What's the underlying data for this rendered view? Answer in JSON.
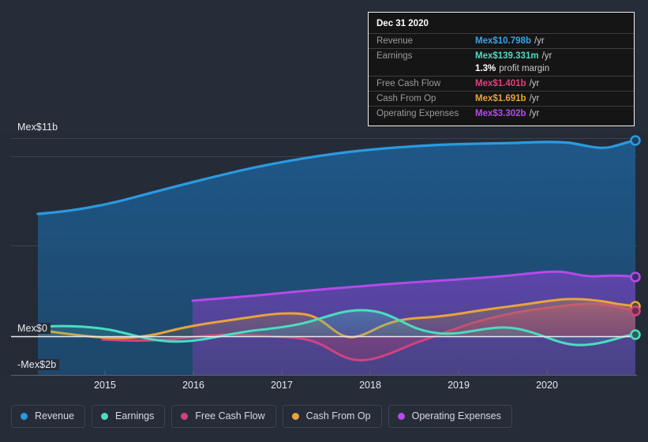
{
  "theme": {
    "background": "#262c38",
    "plot_background": "#252b36",
    "gridline": "#3a4150",
    "zero_line": "#e8eaee",
    "axis_line": "#555c6b",
    "text": "#e8eaee",
    "muted_text": "#9a9a9a"
  },
  "tooltip": {
    "date": "Dec 31 2020",
    "rows": [
      {
        "label": "Revenue",
        "value": "Mex$10.798b",
        "unit": "/yr",
        "color": "#3aa3e8"
      },
      {
        "label": "Earnings",
        "value": "Mex$139.331m",
        "unit": "/yr",
        "color": "#4bdcc0"
      },
      {
        "label": "",
        "value": "1.3%",
        "unit": "profit margin",
        "color": "#ffffff"
      },
      {
        "label": "Free Cash Flow",
        "value": "Mex$1.401b",
        "unit": "/yr",
        "color": "#e0407f"
      },
      {
        "label": "Cash From Op",
        "value": "Mex$1.691b",
        "unit": "/yr",
        "color": "#e8a33d"
      },
      {
        "label": "Operating Expenses",
        "value": "Mex$3.302b",
        "unit": "/yr",
        "color": "#b54ae8"
      }
    ]
  },
  "legend": {
    "items": [
      {
        "label": "Revenue",
        "color": "#2b9ae0"
      },
      {
        "label": "Earnings",
        "color": "#4bdcc0"
      },
      {
        "label": "Free Cash Flow",
        "color": "#d1437e"
      },
      {
        "label": "Cash From Op",
        "color": "#e8a33d"
      },
      {
        "label": "Operating Expenses",
        "color": "#b54ae8"
      }
    ]
  },
  "chart_data": {
    "type": "area",
    "title": "",
    "xlabel": "",
    "ylabel": "",
    "currency": "Mex$",
    "grid": true,
    "legend_position": "bottom",
    "y_axis": {
      "ticks": [
        "Mex$11b",
        "Mex$0",
        "-Mex$2b"
      ],
      "tick_values": [
        11,
        0,
        -2
      ],
      "ylim": [
        -2,
        11
      ],
      "unit": "billions Mex$"
    },
    "x_axis": {
      "tick_labels": [
        "2015",
        "2016",
        "2017",
        "2018",
        "2019",
        "2020"
      ],
      "xlim": [
        "2014-07",
        "2021-03"
      ]
    },
    "x": [
      "2014-09",
      "2015-03",
      "2015-09",
      "2016-03",
      "2016-09",
      "2017-03",
      "2017-09",
      "2018-03",
      "2018-09",
      "2019-03",
      "2019-09",
      "2020-03",
      "2020-09",
      "2020-12"
    ],
    "series": [
      {
        "name": "Revenue",
        "color": "#2b9ae0",
        "fill": "rgba(41,110,165,0.55)",
        "end_value": 10.798,
        "values": [
          5.95,
          6.35,
          6.85,
          7.55,
          8.0,
          8.45,
          8.95,
          9.25,
          9.55,
          9.85,
          10.1,
          10.55,
          10.3,
          10.798
        ]
      },
      {
        "name": "Earnings",
        "color": "#4bdcc0",
        "fill": "rgba(75,220,192,0.22)",
        "end_value": 0.139,
        "values": [
          0.45,
          0.3,
          -0.1,
          -0.2,
          0.15,
          0.35,
          0.6,
          0.75,
          0.35,
          0.55,
          0.3,
          -0.25,
          -0.2,
          0.139
        ]
      },
      {
        "name": "Free Cash Flow",
        "color": "#d1437e",
        "fill": "rgba(209,67,126,0.30)",
        "end_value": 1.401,
        "values": [
          null,
          -0.2,
          -0.2,
          0.05,
          -0.1,
          -0.1,
          -0.95,
          -1.4,
          -1.15,
          -0.3,
          0.25,
          0.55,
          1.25,
          1.401
        ]
      },
      {
        "name": "Cash From Op",
        "color": "#e8a33d",
        "fill": "rgba(232,163,61,0.18)",
        "end_value": 1.691,
        "values": [
          0.25,
          -0.05,
          -0.15,
          0.25,
          0.55,
          0.8,
          0.5,
          -0.05,
          0.35,
          0.55,
          0.85,
          1.05,
          1.55,
          1.691
        ]
      },
      {
        "name": "Operating Expenses",
        "color": "#b54ae8",
        "fill": "rgba(120,70,190,0.55)",
        "end_value": 3.302,
        "values": [
          null,
          null,
          null,
          1.7,
          1.9,
          2.1,
          2.3,
          2.5,
          2.65,
          2.85,
          3.1,
          3.3,
          3.2,
          3.302
        ]
      }
    ]
  }
}
